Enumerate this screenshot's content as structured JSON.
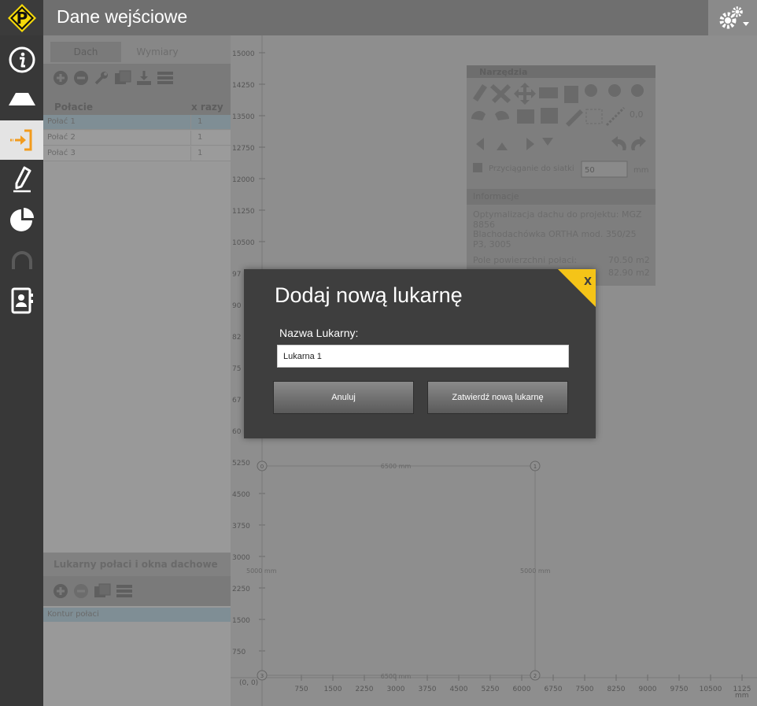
{
  "header": {
    "title": "Dane wejściowe",
    "logo_letter": "P",
    "logo_color": "#f5d90a"
  },
  "rail": {
    "items": [
      {
        "icon": "info-icon"
      },
      {
        "icon": "roof-icon"
      },
      {
        "icon": "input-icon",
        "active": true
      },
      {
        "icon": "pencil-icon"
      },
      {
        "icon": "pie-chart-icon"
      },
      {
        "icon": "arch-icon"
      },
      {
        "icon": "contact-book-icon"
      }
    ],
    "accent": "#f29b1d"
  },
  "panel": {
    "tabs": [
      "Dach",
      "Wymiary"
    ],
    "columns": {
      "name": "Połacie",
      "count": "x razy"
    },
    "rows": [
      {
        "name": "Połać 1",
        "count": "1"
      },
      {
        "name": "Połać 2",
        "count": "1"
      },
      {
        "name": "Połać 3",
        "count": "1"
      }
    ],
    "lukarny_title": "Lukarny połaci i okna dachowe",
    "kontur": "Kontur połaci"
  },
  "canvas": {
    "y_ticks": [
      "15000",
      "14250",
      "13500",
      "12750",
      "12000",
      "11250",
      "10500",
      "97",
      "90",
      "82",
      "75",
      "67",
      "60",
      "5250",
      "4500",
      "3750",
      "3000",
      "2250",
      "1500",
      "750"
    ],
    "origin_label": "(0, 0)",
    "x_ticks": [
      "750",
      "1500",
      "2250",
      "3000",
      "3750",
      "4500",
      "5250",
      "6000",
      "6750",
      "7500",
      "8250",
      "9000",
      "9750",
      "10500",
      "1125"
    ],
    "unit": "mm",
    "dim_top": "6500 mm",
    "dim_bottom": "6500 mm",
    "dim_left": "5000 mm",
    "dim_right": "5000 mm",
    "corners": [
      "0",
      "1",
      "2",
      "3"
    ]
  },
  "palette": {
    "title": "Narzędzia",
    "snap_label": "Przyciąganie do siatki",
    "snap_value": "50",
    "snap_unit": "mm",
    "angle": "0,0",
    "info_title": "Informacje",
    "info_line1": "Optymalizacja dachu do projektu: MGZ",
    "info_line2": "8856",
    "info_line3": "Blachodachówka ORTHA mod. 350/25",
    "info_line4": "P3, 3005",
    "area_label": "Pole powierzchni połaci:",
    "area_value1": "70.50 m2",
    "area_value2": "82.90 m2"
  },
  "modal": {
    "title": "Dodaj nową lukarnę",
    "close": "X",
    "label": "Nazwa Lukarny:",
    "input_value": "Lukarna 1",
    "cancel": "Anuluj",
    "confirm": "Zatwierdź nową lukarnę",
    "accent": "#f5c418"
  }
}
